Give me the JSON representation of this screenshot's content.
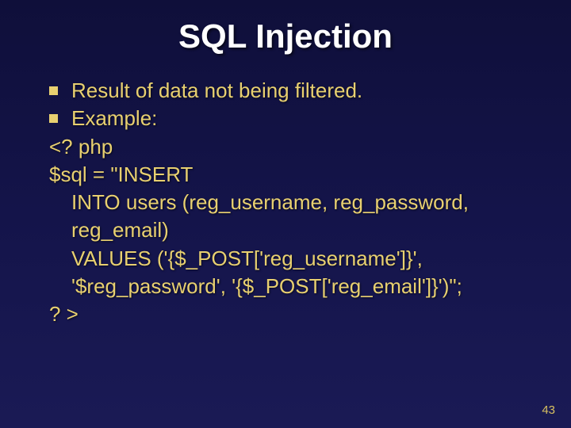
{
  "title": "SQL Injection",
  "bullets": [
    "Result of data not being filtered.",
    "Example:"
  ],
  "code": {
    "l1": "<? php",
    "l2": "$sql = \"INSERT",
    "l3": "INTO users (reg_username, reg_password,",
    "l4": "reg_email)",
    "l5": "VALUES ('{$_POST['reg_username']}',",
    "l6": "'$reg_password', '{$_POST['reg_email']}')\";",
    "l7": "? >"
  },
  "page_number": "43"
}
